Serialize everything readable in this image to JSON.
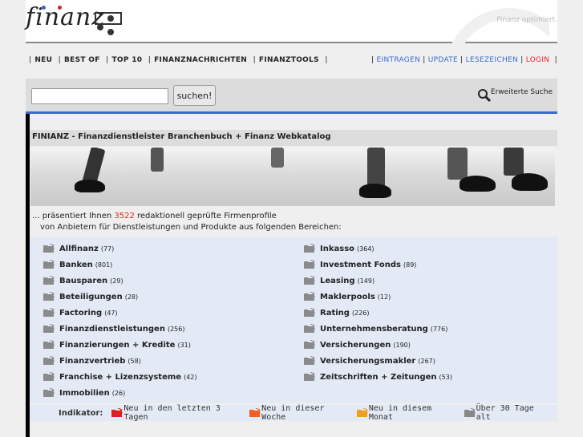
{
  "header": {
    "logo": "finanz",
    "tagline": "Finanz optimiert."
  },
  "nav_left": [
    "NEU",
    "BEST OF",
    "TOP 10",
    "FINANZNACHRICHTEN",
    "FINANZTOOLS"
  ],
  "nav_right": [
    {
      "label": "EINTRAGEN"
    },
    {
      "label": "UPDATE"
    },
    {
      "label": "LESEZEICHEN"
    },
    {
      "label": "LOGIN"
    }
  ],
  "search": {
    "value": "",
    "button": "suchen!",
    "advanced": "Erweiterte Suche"
  },
  "title": "FINIANZ - Finanzdienstleister Branchenbuch + Finanz Webkatalog",
  "intro": {
    "pre": "... präsentiert Ihnen ",
    "count": "3522",
    "post": " redaktionell geprüfte Firmenprofile",
    "line2": "von Anbietern für Dienstleistungen und Produkte aus folgenden Bereichen:"
  },
  "categories_left": [
    {
      "name": "Allfinanz",
      "count": "(77)"
    },
    {
      "name": "Banken",
      "count": "(801)"
    },
    {
      "name": "Bausparen",
      "count": "(29)"
    },
    {
      "name": "Beteiligungen",
      "count": "(28)"
    },
    {
      "name": "Factoring",
      "count": "(47)"
    },
    {
      "name": "Finanzdienstleistungen",
      "count": "(256)"
    },
    {
      "name": "Finanzierungen + Kredite",
      "count": "(31)"
    },
    {
      "name": "Finanzvertrieb",
      "count": "(58)"
    },
    {
      "name": "Franchise + Lizenzsysteme",
      "count": "(42)"
    },
    {
      "name": "Immobilien",
      "count": "(26)"
    }
  ],
  "categories_right": [
    {
      "name": "Inkasso",
      "count": "(364)"
    },
    {
      "name": "Investment Fonds",
      "count": "(89)"
    },
    {
      "name": "Leasing",
      "count": "(149)"
    },
    {
      "name": "Maklerpools",
      "count": "(12)"
    },
    {
      "name": "Rating",
      "count": "(226)"
    },
    {
      "name": "Unternehmensberatung",
      "count": "(776)"
    },
    {
      "name": "Versicherungen",
      "count": "(190)"
    },
    {
      "name": "Versicherungsmakler",
      "count": "(267)"
    },
    {
      "name": "Zeitschriften + Zeitungen",
      "count": "(53)"
    }
  ],
  "indicator": {
    "label": "Indikator:",
    "items": [
      {
        "text": "Neu in den letzten 3 Tagen",
        "color": "#e02020"
      },
      {
        "text": "Neu in dieser Woche",
        "color": "#f06020"
      },
      {
        "text": "Neu in diesem Monat",
        "color": "#f0a020"
      },
      {
        "text": "Über 30 Tage alt",
        "color": "#888888"
      }
    ]
  }
}
